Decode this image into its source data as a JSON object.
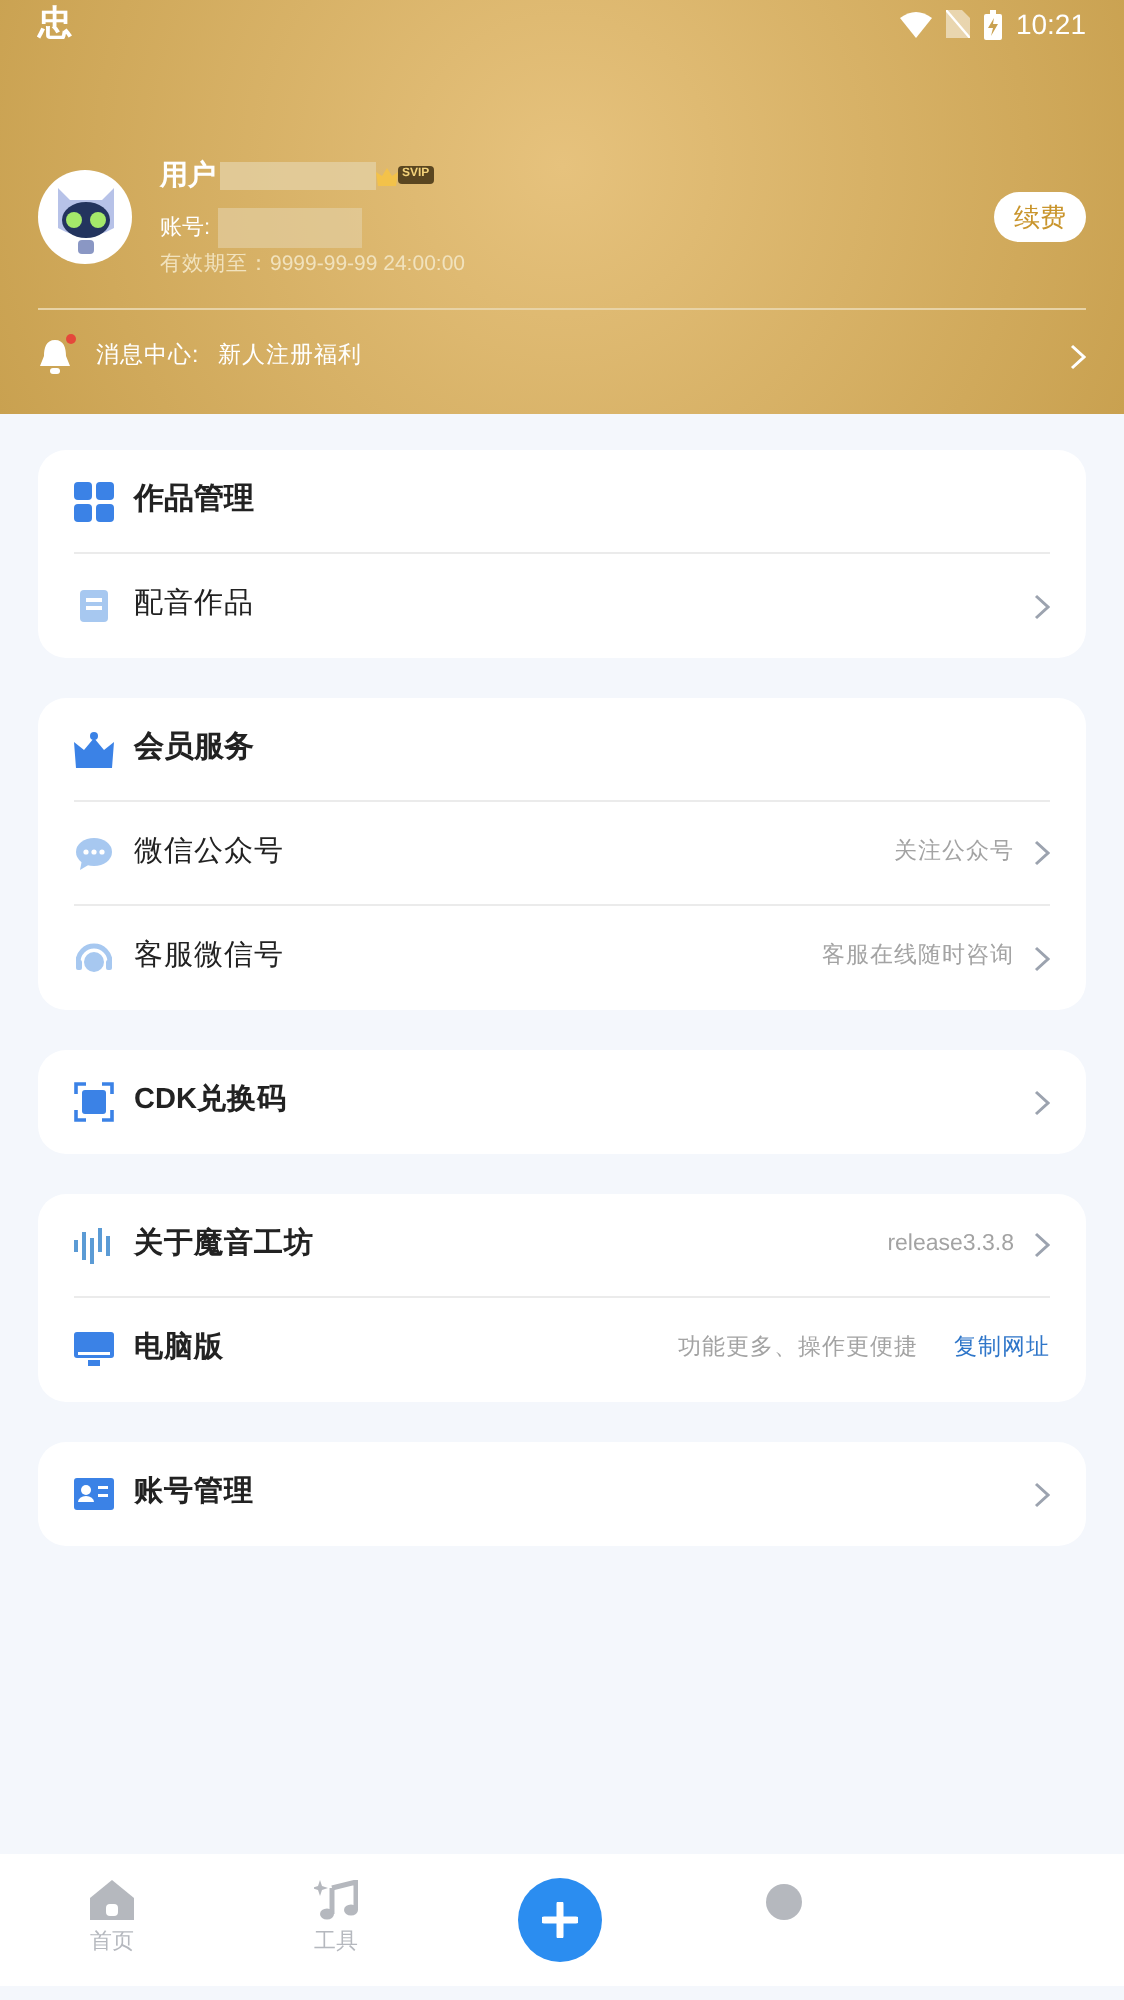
{
  "status_bar": {
    "app_glyph": "忠",
    "time": "10:21"
  },
  "profile": {
    "name": "用户",
    "badge": "SVIP",
    "account_label": "账号:",
    "expiry": "有效期至：9999-99-99 24:00:00",
    "renew_button": "续费"
  },
  "notice": {
    "label": "消息中心:",
    "message": "新人注册福利",
    "unread": true
  },
  "cards": [
    {
      "rows": [
        {
          "kind": "header",
          "label": "作品管理"
        },
        {
          "kind": "item",
          "label": "配音作品",
          "bold": false
        }
      ]
    },
    {
      "rows": [
        {
          "kind": "header",
          "label": "会员服务"
        },
        {
          "kind": "item",
          "label": "微信公众号",
          "hint": "关注公众号",
          "bold": false
        },
        {
          "kind": "item",
          "label": "客服微信号",
          "hint": "客服在线随时咨询",
          "bold": false
        }
      ]
    },
    {
      "rows": [
        {
          "kind": "item",
          "label": "CDK兑换码",
          "bold": true
        }
      ]
    },
    {
      "rows": [
        {
          "kind": "item",
          "label": "关于魔音工坊",
          "hint": "release3.3.8",
          "bold": true
        },
        {
          "kind": "link",
          "label": "电脑版",
          "hint": "功能更多、操作更便捷",
          "link": "复制网址",
          "bold": true
        }
      ]
    },
    {
      "rows": [
        {
          "kind": "item",
          "label": "账号管理",
          "bold": true
        }
      ]
    }
  ],
  "tab_bar": [
    {
      "kind": "home",
      "label": "首页",
      "selected": false
    },
    {
      "kind": "tools",
      "label": "工具",
      "selected": false
    },
    {
      "kind": "add"
    },
    {
      "kind": "partial",
      "selected": false
    }
  ]
}
